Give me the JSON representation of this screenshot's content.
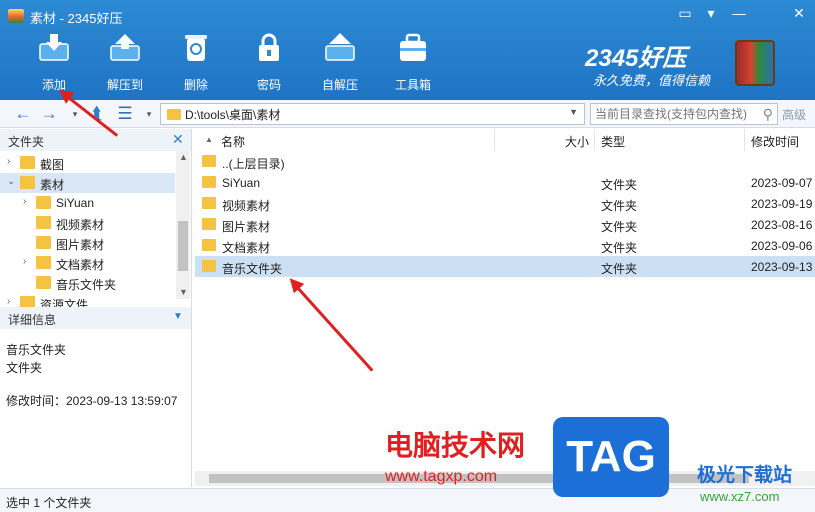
{
  "window": {
    "title": "素材 - 2345好压"
  },
  "toolbar": {
    "items": [
      {
        "label": "添加",
        "icon": "add-archive-icon"
      },
      {
        "label": "解压到",
        "icon": "extract-icon"
      },
      {
        "label": "删除",
        "icon": "recycle-bin-icon"
      },
      {
        "label": "密码",
        "icon": "lock-icon"
      },
      {
        "label": "自解压",
        "icon": "self-extract-icon"
      },
      {
        "label": "工具箱",
        "icon": "toolbox-icon"
      }
    ]
  },
  "brand": {
    "name": "2345好压",
    "slogan": "永久免费，值得信赖"
  },
  "nav": {
    "path": "D:\\tools\\桌面\\素材",
    "search_placeholder": "当前目录查找(支持包内查找)",
    "advanced_label": "高级"
  },
  "sidebar": {
    "header": "文件夹",
    "tree": [
      {
        "label": "截图",
        "level": 0,
        "expander": "›"
      },
      {
        "label": "素材",
        "level": 0,
        "expander": "⌄",
        "selected": true
      },
      {
        "label": "SiYuan",
        "level": 1,
        "expander": "›"
      },
      {
        "label": "视频素材",
        "level": 1,
        "expander": ""
      },
      {
        "label": "图片素材",
        "level": 1,
        "expander": ""
      },
      {
        "label": "文档素材",
        "level": 1,
        "expander": "›"
      },
      {
        "label": "音乐文件夹",
        "level": 1,
        "expander": ""
      },
      {
        "label": "资源文件",
        "level": 0,
        "expander": "›"
      }
    ],
    "details_header": "详细信息",
    "details": {
      "name": "音乐文件夹",
      "type": "文件夹",
      "modified": "修改时间：2023-09-13 13:59:07"
    }
  },
  "filelist": {
    "columns": {
      "name": "名称",
      "size": "大小",
      "type": "类型",
      "modified": "修改时间"
    },
    "rows": [
      {
        "name": "..(上层目录)",
        "size": "",
        "type": "",
        "modified": ""
      },
      {
        "name": "SiYuan",
        "size": "",
        "type": "文件夹",
        "modified": "2023-09-07"
      },
      {
        "name": "视频素材",
        "size": "",
        "type": "文件夹",
        "modified": "2023-09-19"
      },
      {
        "name": "图片素材",
        "size": "",
        "type": "文件夹",
        "modified": "2023-08-16"
      },
      {
        "name": "文档素材",
        "size": "",
        "type": "文件夹",
        "modified": "2023-09-06"
      },
      {
        "name": "音乐文件夹",
        "size": "",
        "type": "文件夹",
        "modified": "2023-09-13",
        "selected": true
      }
    ]
  },
  "status": {
    "text": "选中 1 个文件夹"
  },
  "watermark": {
    "site_name": "电脑技术网",
    "site_url": "www.tagxp.com",
    "tag": "TAG",
    "site2_name": "极光下载站",
    "site2_url": "www.xz7.com"
  },
  "colors": {
    "accent": "#1f74c4",
    "selection": "#cce0f4",
    "arrow": "#e02020",
    "folder": "#f5c342"
  }
}
